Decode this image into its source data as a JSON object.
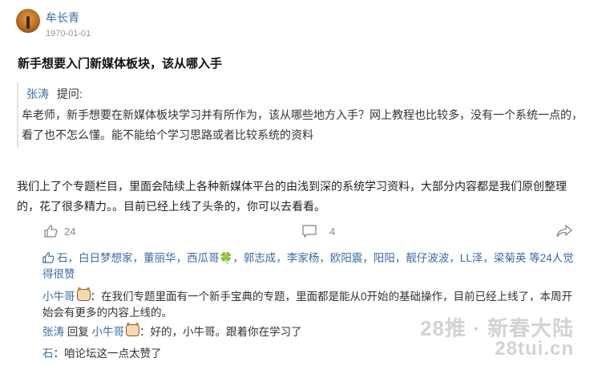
{
  "post": {
    "author": "牟长青",
    "date": "1970-01-01",
    "title": "新手想要入门新媒体板块，该从哪入手"
  },
  "question": {
    "asker": "张涛",
    "label": "提问:",
    "body": "牟老师，新手想要在新媒体板块学习并有所作为，该从哪些地方入手？网上教程也比较多，没有一个系统一点的，看了也不怎么懂。能不能给个学习思路或者比较系统的资料"
  },
  "answer": {
    "body": "我们上了个专题栏目，里面会陆续上各种新媒体平台的由浅到深的系统学习资料，大部分内容都是我们原创整理的，花了很多精力。。目前已经上线了头条的，你可以去看看。"
  },
  "actions": {
    "like_count": "24",
    "comment_count": "4",
    "icons": [
      "thumbs-up-icon",
      "comment-icon",
      "share-icon"
    ]
  },
  "likers": {
    "names": "石，白日梦想家，董丽华，西瓜哥",
    "names2": "，郭志成，李家杨，欧阳震，阳阳，靓仔波波，LL泽，梁菊英",
    "tail": "等24人觉得很赞",
    "clover": "🍀"
  },
  "comments": [
    {
      "user": "小牛哥",
      "text": "：在我们专题里面有一个新手宝典的专题，里面都是能从0开始的基础操作，目前已经上线了，本周开始会有更多的内容上线的。"
    },
    {
      "user": "张涛",
      "reply_word": "回复",
      "reply_to": "小牛哥",
      "text": "：好的，小牛哥。跟着你在学习了"
    },
    {
      "user": "石",
      "text": "：咱论坛这一点太赞了"
    }
  ],
  "watermark": {
    "line1": "28推 · 新春大陆",
    "line2": "28tui.cn"
  }
}
